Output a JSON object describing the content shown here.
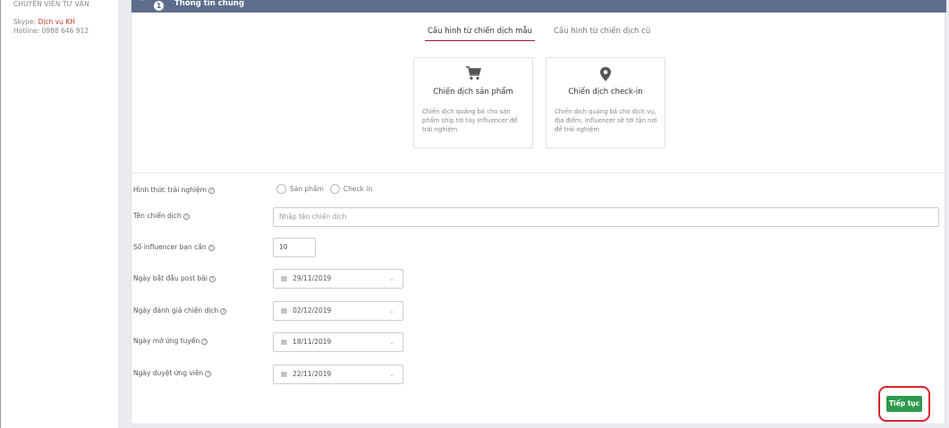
{
  "sidebar": {
    "title": "CHUYÊN VIÊN TƯ VẤN",
    "skype_label": "Skype:",
    "skype_value": "Dịch vụ KH",
    "hotline_label": "Hotline:",
    "hotline_value": "0988 646 912"
  },
  "panel": {
    "step_number": "1",
    "title": "Thông tin chung",
    "collapse_icon": "chevron-up-icon"
  },
  "tabs": [
    {
      "label": "Cấu hình từ chiến dịch mẫu",
      "active": true
    },
    {
      "label": "Cấu hình từ chiến dịch cũ",
      "active": false
    }
  ],
  "cards": [
    {
      "icon": "cart-icon",
      "title": "Chiến dịch sản phẩm",
      "description": "Chiến dịch quảng bá cho sản phẩm ship tới tay Influencer để trải nghiệm"
    },
    {
      "icon": "location-pin-icon",
      "title": "Chiến dịch check-in",
      "description": "Chiến dịch quảng bá cho dịch vụ, địa điểm, Influencer sẽ tới tận nơi để trải nghiệm"
    }
  ],
  "form": {
    "experience": {
      "label": "Hình thức trải nghiệm",
      "options": [
        "Sản phẩm",
        "Check in"
      ]
    },
    "campaign_name": {
      "label": "Tên chiến dịch",
      "placeholder": "Nhập tên chiến dịch"
    },
    "influencer_count": {
      "label": "Số influencer bạn cần",
      "value": "10"
    },
    "post_start": {
      "label": "Ngày bắt đầu post bài",
      "value": "29/11/2019"
    },
    "review_date": {
      "label": "Ngày đánh giá chiến dịch",
      "value": "02/12/2019"
    },
    "open_apply": {
      "label": "Ngày mở ứng tuyển",
      "value": "18/11/2019"
    },
    "approve_date": {
      "label": "Ngày duyệt ứng viên",
      "value": "22/11/2019"
    }
  },
  "actions": {
    "next_label": "Tiếp tục",
    "next_color": "#2e9a4d",
    "highlight_color": "#d9232d"
  },
  "colors": {
    "header_bg": "#5d6d8c",
    "tab_accent": "#a2153c",
    "link": "#c0392b"
  }
}
